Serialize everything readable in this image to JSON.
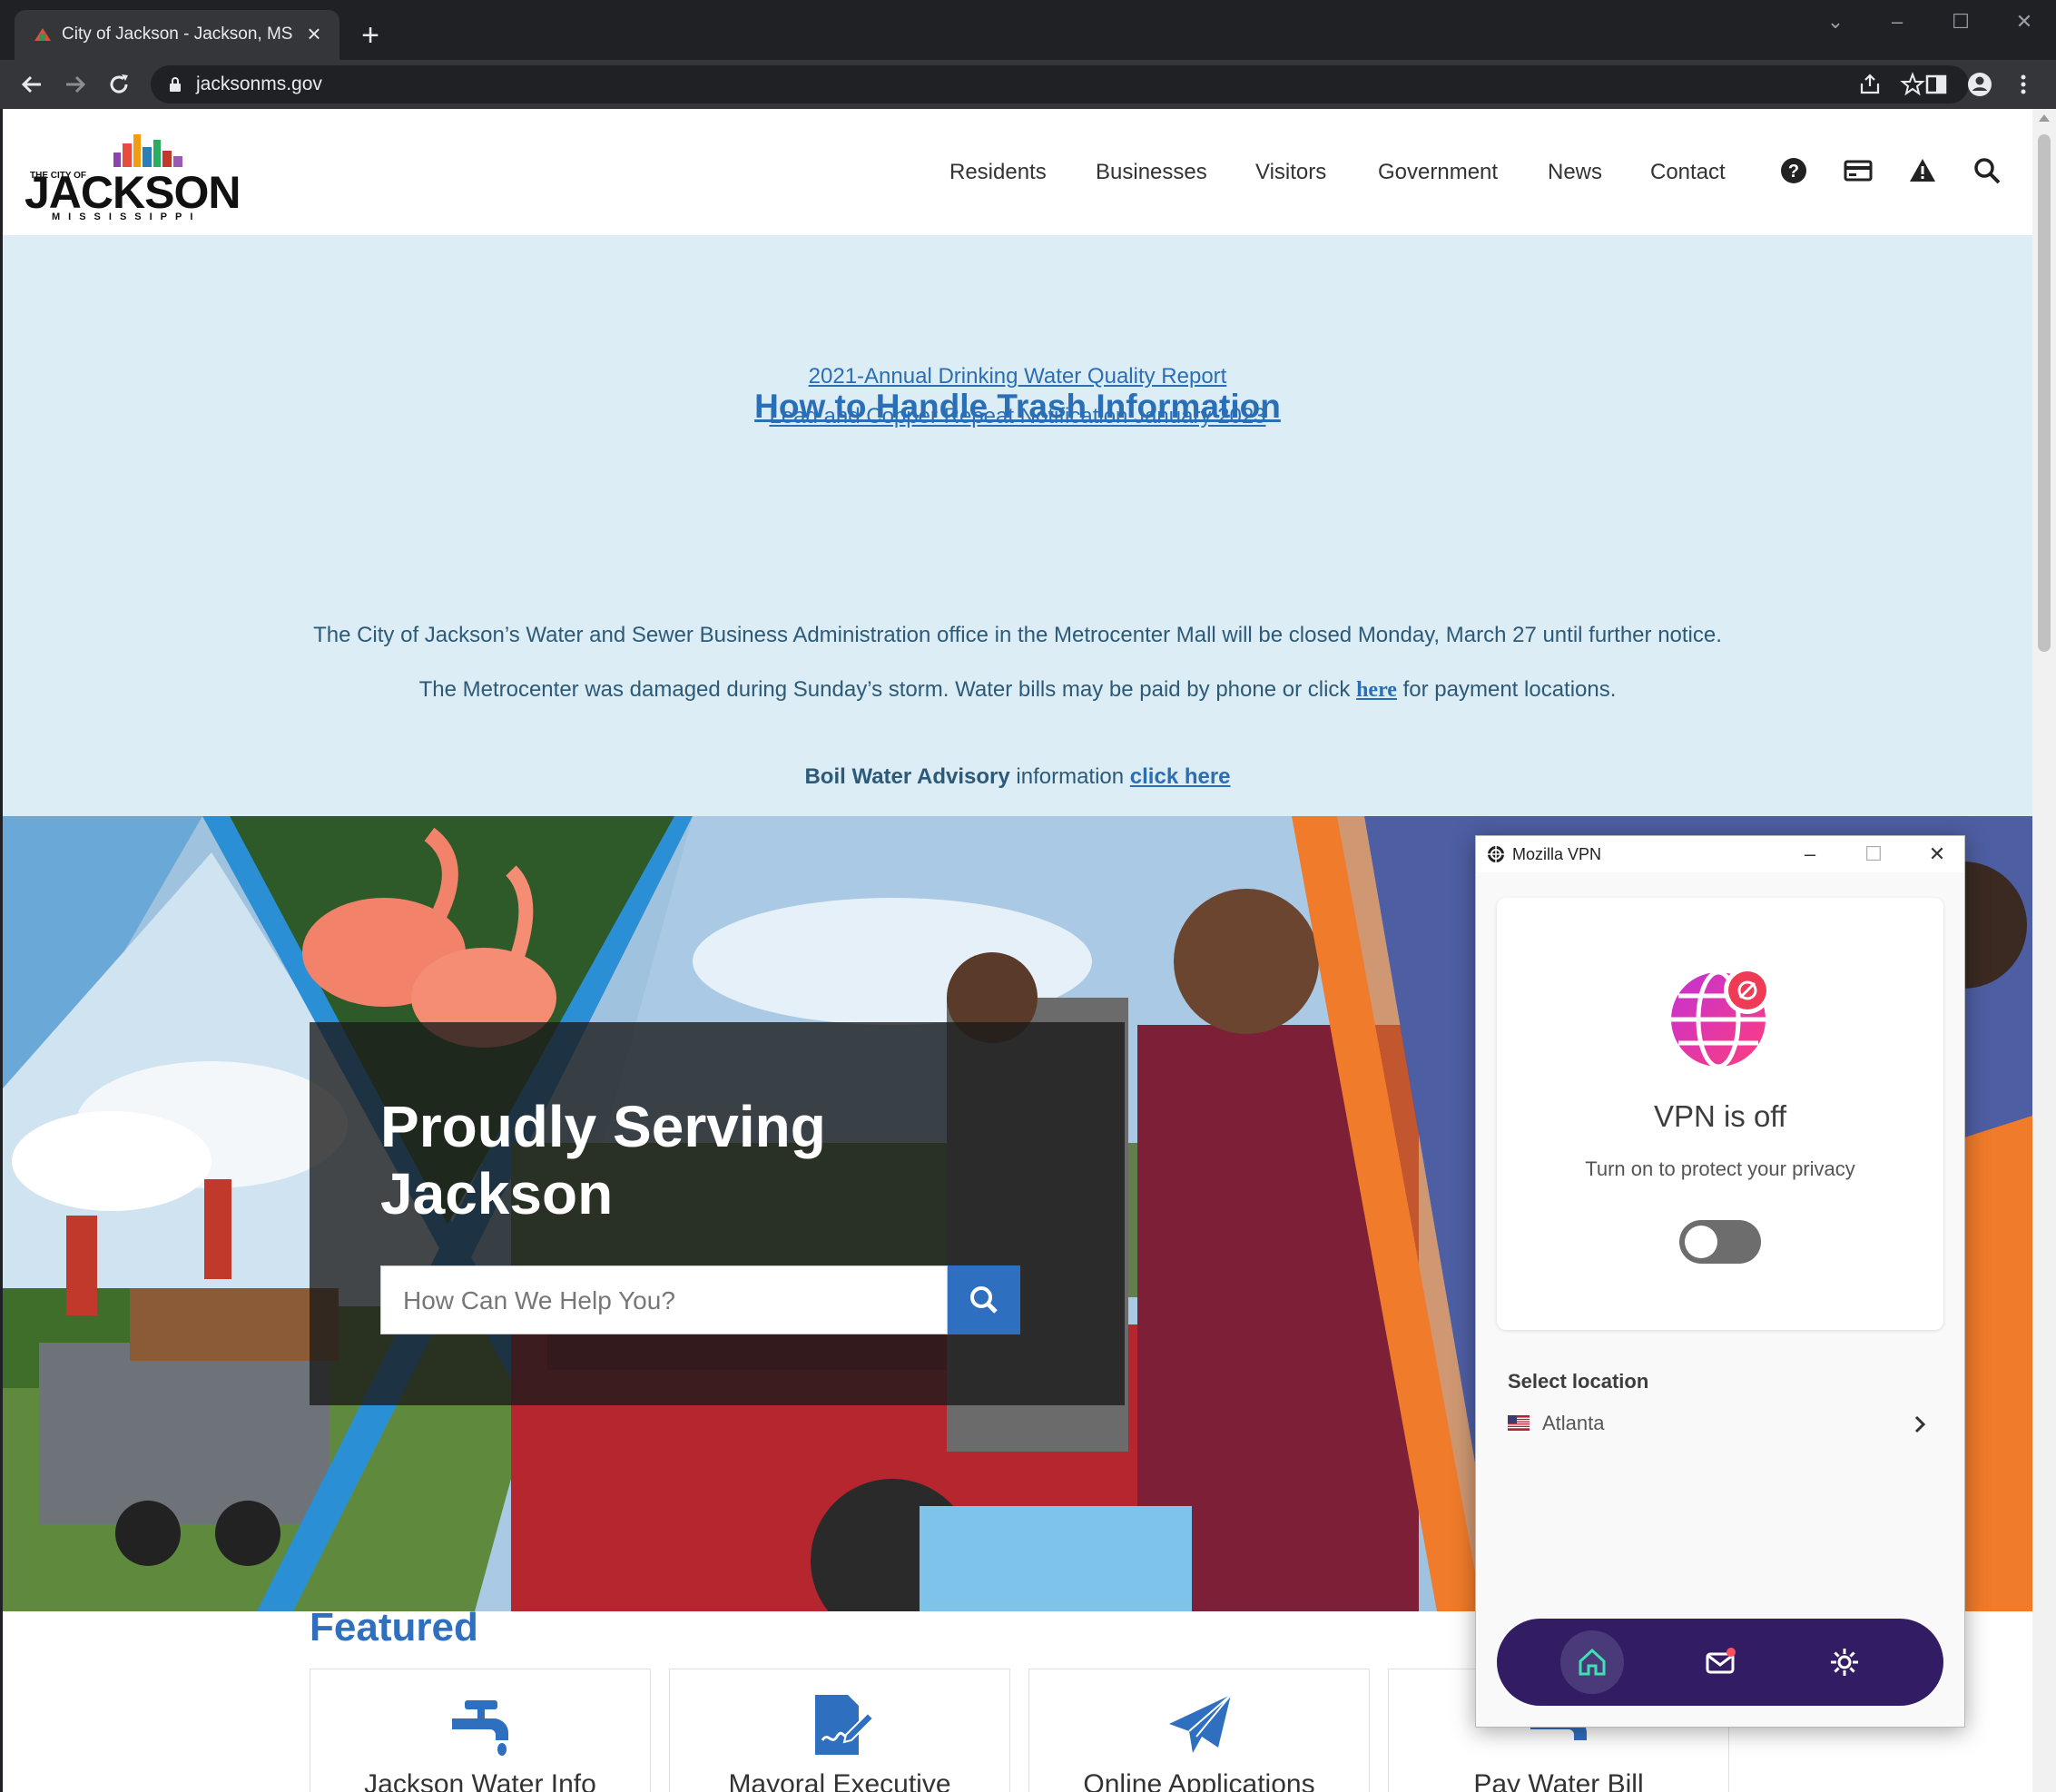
{
  "browser": {
    "tab_title": "City of Jackson - Jackson, MS",
    "url": "jacksonms.gov"
  },
  "site": {
    "logo_text": {
      "top": "THE CITY OF",
      "main": "JACKSON",
      "bottom": "MISSISSIPPI"
    },
    "nav": [
      "Residents",
      "Businesses",
      "Visitors",
      "Government",
      "News",
      "Contact"
    ],
    "header_icons": [
      "help-icon",
      "payment-card-icon",
      "alert-icon",
      "search-icon"
    ]
  },
  "alerts": {
    "link1": "2021-Annual Drinking Water Quality Report",
    "link2": "Lead and Copper Repeat Notification January 2023",
    "headline": "How to Handle Trash Information",
    "notice1": "The City of Jackson’s Water and Sewer Business Administration office in the Metrocenter Mall will be closed Monday, March 27 until further notice.",
    "notice2_before": "The Metrocenter was damaged during Sunday’s storm. Water bills may be paid by phone or click ",
    "notice2_link": "here",
    "notice2_after": " for payment locations.",
    "boil_bold": "Boil Water Advisory",
    "boil_mid": " information ",
    "boil_link": "click here"
  },
  "hero": {
    "title": "Proudly Serving Jackson",
    "search_placeholder": "How Can We Help You?"
  },
  "featured": {
    "title": "Featured",
    "cards": [
      "Jackson Water Info",
      "Mayoral Executive",
      "Online Applications",
      "Pay Water Bill"
    ]
  },
  "vpn": {
    "window_title": "Mozilla VPN",
    "status": "VPN is off",
    "subtitle": "Turn on to protect your privacy",
    "toggle_on": false,
    "select_location_label": "Select location",
    "location": "Atlanta",
    "nav_icons": [
      "home-icon",
      "messages-icon",
      "settings-icon"
    ]
  },
  "colors": {
    "accent_blue": "#2f6fbf",
    "alert_band": "#dcedf5",
    "vpn_nav": "#321c64",
    "vpn_magenta": "#e531a8"
  }
}
